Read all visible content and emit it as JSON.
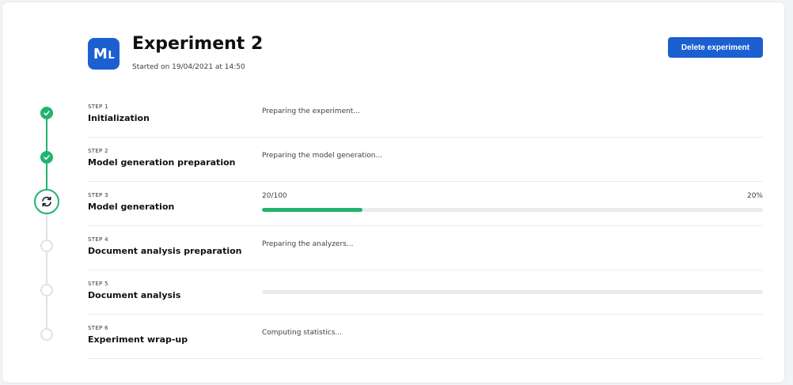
{
  "header": {
    "app_icon": {
      "text_big": "M",
      "text_small": "L",
      "color": "#1c5fd0"
    },
    "title": "Experiment 2",
    "subtitle": "Started on 19/04/2021 at 14:50",
    "delete_label": "Delete experiment"
  },
  "colors": {
    "accent": "#1c5fd0",
    "success": "#22b370",
    "muted": "#dfe2e6"
  },
  "steps": [
    {
      "label": "STEP 1",
      "name": "Initialization",
      "state": "done",
      "status": "Preparing the experiment..."
    },
    {
      "label": "STEP 2",
      "name": "Model generation preparation",
      "state": "done",
      "status": "Preparing the model generation..."
    },
    {
      "label": "STEP 3",
      "name": "Model generation",
      "state": "active",
      "progress_text": "20/100",
      "progress_percent": "20%",
      "progress_fraction": 0.2
    },
    {
      "label": "STEP 4",
      "name": "Document analysis preparation",
      "state": "pending",
      "status": "Preparing the analyzers..."
    },
    {
      "label": "STEP 5",
      "name": "Document analysis",
      "state": "pending",
      "progress_fraction": 0
    },
    {
      "label": "STEP 6",
      "name": "Experiment wrap-up",
      "state": "pending",
      "status": "Computing statistics..."
    }
  ],
  "icons": {
    "done": "check-icon",
    "active": "sync-icon"
  }
}
